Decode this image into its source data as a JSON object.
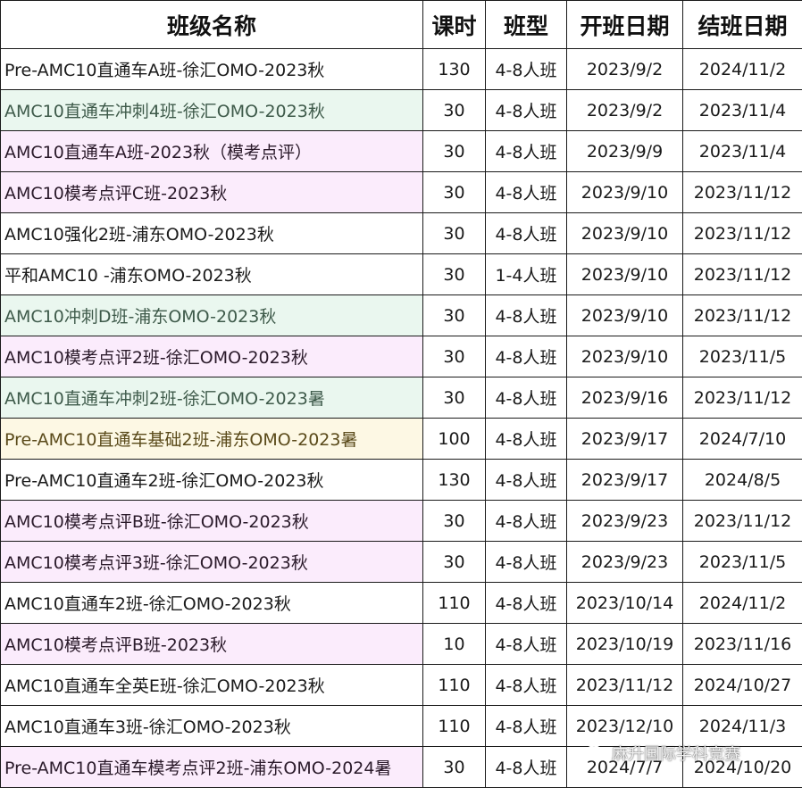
{
  "headers": {
    "name": "班级名称",
    "hours": "课时",
    "type": "班型",
    "start": "开班日期",
    "end": "结班日期"
  },
  "rows": [
    {
      "name": "Pre-AMC10直通车A班-徐汇OMO-2023秋",
      "hours": "130",
      "type": "4-8人班",
      "start": "2023/9/2",
      "end": "2024/11/2",
      "bg": "white"
    },
    {
      "name": "AMC10直通车冲刺4班-徐汇OMO-2023秋",
      "hours": "30",
      "type": "4-8人班",
      "start": "2023/9/2",
      "end": "2023/11/4",
      "bg": "green"
    },
    {
      "name": "AMC10直通车A班-2023秋（模考点评）",
      "hours": "30",
      "type": "4-8人班",
      "start": "2023/9/9",
      "end": "2023/11/4",
      "bg": "pink"
    },
    {
      "name": "AMC10模考点评C班-2023秋",
      "hours": "30",
      "type": "4-8人班",
      "start": "2023/9/10",
      "end": "2023/11/12",
      "bg": "pink"
    },
    {
      "name": "AMC10强化2班-浦东OMO-2023秋",
      "hours": "30",
      "type": "4-8人班",
      "start": "2023/9/10",
      "end": "2023/11/12",
      "bg": "white"
    },
    {
      "name": "平和AMC10 -浦东OMO-2023秋",
      "hours": "30",
      "type": "1-4人班",
      "start": "2023/9/10",
      "end": "2023/11/12",
      "bg": "white"
    },
    {
      "name": "AMC10冲刺D班-浦东OMO-2023秋",
      "hours": "30",
      "type": "4-8人班",
      "start": "2023/9/10",
      "end": "2023/11/12",
      "bg": "green"
    },
    {
      "name": "AMC10模考点评2班-徐汇OMO-2023秋",
      "hours": "30",
      "type": "4-8人班",
      "start": "2023/9/10",
      "end": "2023/11/5",
      "bg": "pink"
    },
    {
      "name": "AMC10直通车冲刺2班-徐汇OMO-2023暑",
      "hours": "30",
      "type": "4-8人班",
      "start": "2023/9/16",
      "end": "2023/11/12",
      "bg": "green"
    },
    {
      "name": "Pre-AMC10直通车基础2班-浦东OMO-2023暑",
      "hours": "100",
      "type": "4-8人班",
      "start": "2023/9/17",
      "end": "2024/7/10",
      "bg": "yellow"
    },
    {
      "name": "Pre-AMC10直通车2班-徐汇OMO-2023秋",
      "hours": "130",
      "type": "4-8人班",
      "start": "2023/9/17",
      "end": "2024/8/5",
      "bg": "white"
    },
    {
      "name": "AMC10模考点评B班-徐汇OMO-2023秋",
      "hours": "30",
      "type": "4-8人班",
      "start": "2023/9/23",
      "end": "2023/11/12",
      "bg": "pink"
    },
    {
      "name": "AMC10模考点评3班-徐汇OMO-2023秋",
      "hours": "30",
      "type": "4-8人班",
      "start": "2023/9/23",
      "end": "2023/11/5",
      "bg": "pink"
    },
    {
      "name": "AMC10直通车2班-徐汇OMO-2023秋",
      "hours": "110",
      "type": "4-8人班",
      "start": "2023/10/14",
      "end": "2024/11/2",
      "bg": "white"
    },
    {
      "name": "AMC10模考点评B班-2023秋",
      "hours": "10",
      "type": "4-8人班",
      "start": "2023/10/19",
      "end": "2023/11/16",
      "bg": "pink"
    },
    {
      "name": "AMC10直通车全英E班-徐汇OMO-2023秋",
      "hours": "110",
      "type": "4-8人班",
      "start": "2023/11/12",
      "end": "2024/10/27",
      "bg": "white"
    },
    {
      "name": "AMC10直通车3班-徐汇OMO-2023秋",
      "hours": "110",
      "type": "4-8人班",
      "start": "2023/12/10",
      "end": "2024/11/3",
      "bg": "white"
    },
    {
      "name": "Pre-AMC10直通车模考点评2班-浦东OMO-2024暑",
      "hours": "30",
      "type": "4-8人班",
      "start": "2024/7/7",
      "end": "2024/10/20",
      "bg": "pink"
    }
  ],
  "watermark": {
    "icon": "wechat-icon",
    "text": "麻升国际学科竞赛"
  }
}
